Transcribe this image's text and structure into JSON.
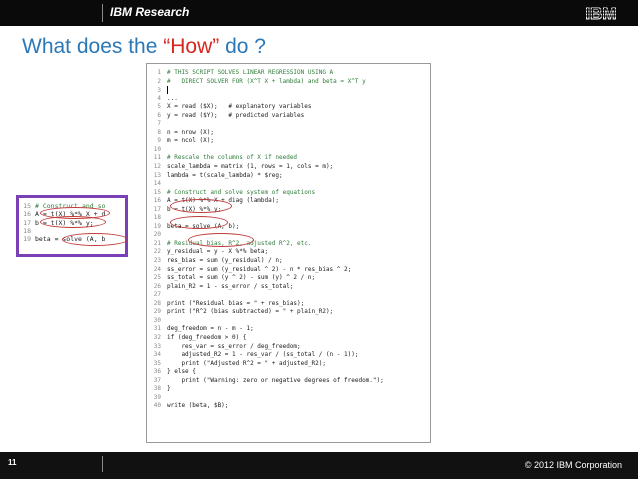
{
  "header": {
    "brand": "IBM Research",
    "logo": "IBM"
  },
  "slide": {
    "title_before": "What does the ",
    "title_highlight": "“How”",
    "title_after": " do ?"
  },
  "footer": {
    "page_number": "11",
    "copyright": "© 2012 IBM Corporation"
  },
  "code_lines": [
    {
      "n": "1",
      "t": "# THIS SCRIPT SOLVES LINEAR REGRESSION USING A"
    },
    {
      "n": "2",
      "t": "#   DIRECT SOLVER FOR (X^T X + lambda) and beta = X^T y"
    },
    {
      "n": "3",
      "t": ""
    },
    {
      "n": "4",
      "t": "..."
    },
    {
      "n": "5",
      "t": "X = read ($X);   # explanatory variables"
    },
    {
      "n": "6",
      "t": "y = read ($Y);   # predicted variables"
    },
    {
      "n": "7",
      "t": ""
    },
    {
      "n": "8",
      "t": "n = nrow (X);"
    },
    {
      "n": "9",
      "t": "m = ncol (X);"
    },
    {
      "n": "10",
      "t": ""
    },
    {
      "n": "11",
      "t": "# Rescale the columns of X if needed"
    },
    {
      "n": "12",
      "t": "scale_lambda = matrix (1, rows = 1, cols = m);"
    },
    {
      "n": "13",
      "t": "lambda = t(scale_lambda) * $reg;"
    },
    {
      "n": "14",
      "t": ""
    },
    {
      "n": "15",
      "t": "# Construct and solve system of equations"
    },
    {
      "n": "16",
      "t": "A = t(X) %*% X + diag (lambda);"
    },
    {
      "n": "17",
      "t": "b = t(X) %*% y;"
    },
    {
      "n": "18",
      "t": ""
    },
    {
      "n": "19",
      "t": "beta = solve (A, b);"
    },
    {
      "n": "20",
      "t": ""
    },
    {
      "n": "21",
      "t": "# Residual bias, R^2, adjusted R^2, etc."
    },
    {
      "n": "22",
      "t": "y_residual = y - X %*% beta;"
    },
    {
      "n": "23",
      "t": "res_bias = sum (y_residual) / n;"
    },
    {
      "n": "24",
      "t": "ss_error = sum (y_residual ^ 2) - n * res_bias ^ 2;"
    },
    {
      "n": "25",
      "t": "ss_total = sum (y ^ 2) - sum (y) ^ 2 / n;"
    },
    {
      "n": "26",
      "t": "plain_R2 = 1 - ss_error / ss_total;"
    },
    {
      "n": "27",
      "t": ""
    },
    {
      "n": "28",
      "t": "print (\"Residual bias = \" + res_bias);"
    },
    {
      "n": "29",
      "t": "print (\"R^2 (bias subtracted) = \" + plain_R2);"
    },
    {
      "n": "30",
      "t": ""
    },
    {
      "n": "31",
      "t": "deg_freedom = n - m - 1;"
    },
    {
      "n": "32",
      "t": "if (deg_freedom > 0) {"
    },
    {
      "n": "33",
      "t": "    res_var = ss_error / deg_freedom;"
    },
    {
      "n": "34",
      "t": "    adjusted_R2 = 1 - res_var / (ss_total / (n - 1));"
    },
    {
      "n": "35",
      "t": "    print (\"Adjusted R^2 = \" + adjusted_R2);"
    },
    {
      "n": "36",
      "t": "} else {"
    },
    {
      "n": "37",
      "t": "    print (\"Warning: zero or negative degrees of freedom.\");"
    },
    {
      "n": "38",
      "t": "}"
    },
    {
      "n": "39",
      "t": ""
    },
    {
      "n": "40",
      "t": "write (beta, $B);"
    }
  ],
  "zoom_lines": [
    {
      "n": "15",
      "t": "# Construct and so"
    },
    {
      "n": "16",
      "t": "A = t(X) %*% X + d"
    },
    {
      "n": "17",
      "t": "b = t(X) %*% y;"
    },
    {
      "n": "18",
      "t": ""
    },
    {
      "n": "19",
      "t": "beta = solve (A, b"
    }
  ],
  "colors": {
    "title": "#2a78b8",
    "highlight": "#d7261e",
    "zoom_border": "#7b3fb6",
    "oval": "#c23b3b"
  }
}
